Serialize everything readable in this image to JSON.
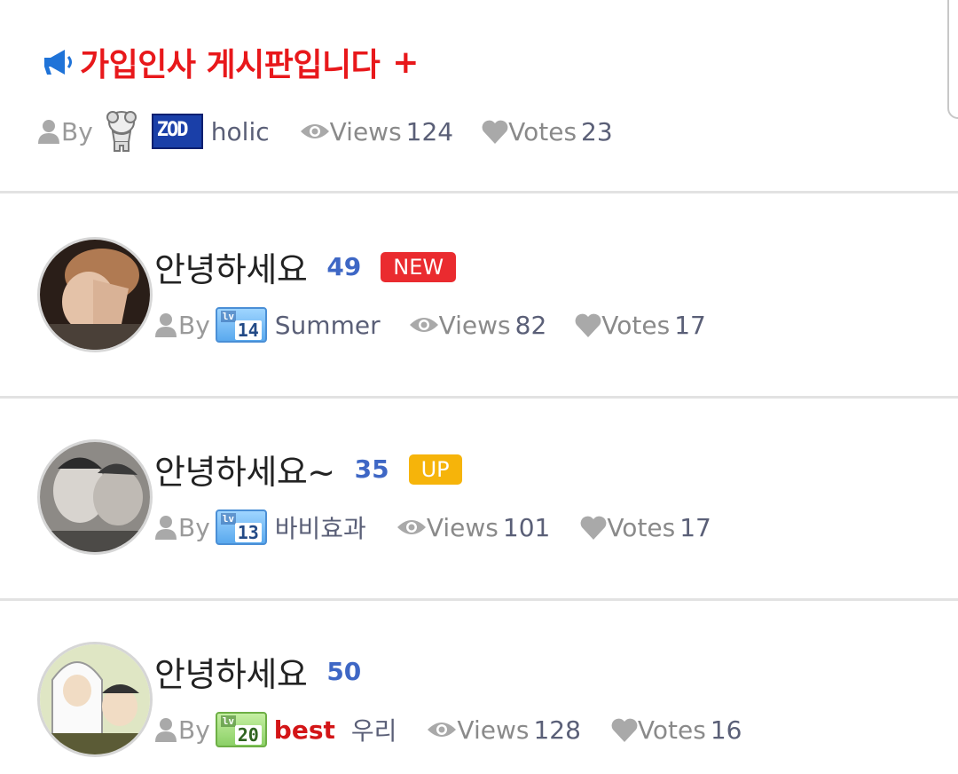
{
  "notice": {
    "icon": "megaphone-icon",
    "title": "가입인사 게시판입니다",
    "add_label": "+",
    "by_label": "By",
    "admin_badge_text": "ZOD",
    "author": "holic",
    "views_label": "Views",
    "views": "124",
    "votes_label": "Votes",
    "votes": "23"
  },
  "posts": [
    {
      "title": "안녕하세요",
      "count": "49",
      "tag": "NEW",
      "by_label": "By",
      "level_prefix": "lv",
      "level": "14",
      "author_prefix": "",
      "author": "Summer",
      "views_label": "Views",
      "views": "82",
      "votes_label": "Votes",
      "votes": "17"
    },
    {
      "title": "안녕하세요~",
      "count": "35",
      "tag": "UP",
      "by_label": "By",
      "level_prefix": "lv",
      "level": "13",
      "author_prefix": "",
      "author": "바비효과",
      "views_label": "Views",
      "views": "101",
      "votes_label": "Votes",
      "votes": "17"
    },
    {
      "title": "안녕하세요",
      "count": "50",
      "tag": "",
      "by_label": "By",
      "level_prefix": "lv",
      "level": "20",
      "author_prefix": "best",
      "author": "우리",
      "views_label": "Views",
      "views": "128",
      "votes_label": "Votes",
      "votes": "16"
    }
  ],
  "colors": {
    "notice_red": "#e8181b",
    "count_blue": "#3e67c5",
    "new_tag": "#ea2b2f",
    "up_tag": "#f6b40a",
    "megaphone_blue": "#1f73d8"
  }
}
